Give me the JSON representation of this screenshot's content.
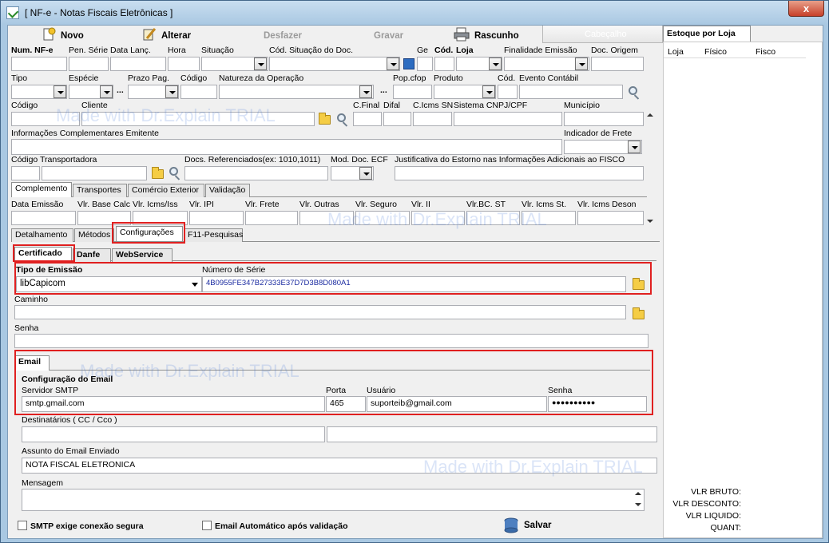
{
  "window": {
    "title": "[ NF-e - Notas Fiscais Eletrônicas ]",
    "close_label": "x"
  },
  "toolbar": {
    "novo": "Novo",
    "alterar": "Alterar",
    "desfazer": "Desfazer",
    "gravar": "Gravar",
    "rascunho": "Rascunho",
    "cabecalho": "Cabeçalho"
  },
  "header_row1": {
    "num_nfe": "Num. NF-e",
    "pen_serie": "Pen. Série",
    "data_lanc": "Data Lanç.",
    "hora": "Hora",
    "situacao": "Situação",
    "cod_situacao": "Cód. Situação do Doc.",
    "ge": "Ge",
    "cod_loja_prefix": "Cód.",
    "cod_loja": "Loja",
    "finalidade": "Finalidade Emissão",
    "doc_origem": "Doc. Origem"
  },
  "header_row2": {
    "tipo": "Tipo",
    "especie": "Espécie",
    "prazo_pag": "Prazo Pag.",
    "codigo": "Código",
    "natureza": "Natureza da Operação",
    "pop_cfop": "Pop.cfop",
    "produto": "Produto",
    "cod_evento": "Cód.",
    "evento_contabil": "Evento Contábil",
    "ellipsis": "..."
  },
  "header_row3": {
    "codigo": "Código",
    "cliente": "Cliente",
    "c_final": "C.Final",
    "difal": "Difal",
    "c_icms_sn": "C.Icms SN",
    "sistema_cnpj": "Sistema CNPJ/CPF",
    "municipio": "Município"
  },
  "header_row4": {
    "info_compl": "Informações Complementares Emitente",
    "indicador_frete": "Indicador de Frete"
  },
  "header_row5": {
    "cod_transportadora": "Código Transportadora",
    "docs_ref": "Docs. Referenciados(ex: 1010,1011)",
    "mod_doc": "Mod. Doc. ECF",
    "justificativa": "Justificativa do Estorno nas Informações Adicionais ao FISCO"
  },
  "tabs1": [
    "Complemento",
    "Transportes",
    "Comércio Exterior",
    "Validação"
  ],
  "complemento": [
    "Data Emissão",
    "Vlr. Base Calc",
    "Vlr. Icms/Iss",
    "Vlr. IPI",
    "Vlr. Frete",
    "Vlr. Outras",
    "Vlr. Seguro",
    "Vlr. II",
    "Vlr.BC. ST",
    "Vlr. Icms St.",
    "Vlr. Icms Deson"
  ],
  "tabs2": [
    "Detalhamento",
    "Métodos",
    "Configurações",
    "F11-Pesquisas"
  ],
  "tabs3": [
    "Certificado",
    "Danfe",
    "WebService"
  ],
  "certificado": {
    "tipo_emissao_label": "Tipo de Emissão",
    "tipo_emissao_value": "libCapicom",
    "numero_serie_label": "Número de Série",
    "numero_serie_value": "4B0955FE347B27333E37D7D3B8D080A1",
    "caminho_label": "Caminho",
    "senha_label": "Senha"
  },
  "email": {
    "tab": "Email",
    "group_title": "Configuração do Email",
    "servidor_label": "Servidor SMTP",
    "servidor_value": "smtp.gmail.com",
    "porta_label": "Porta",
    "porta_value": "465",
    "usuario_label": "Usuário",
    "usuario_value": "suporteib@gmail.com",
    "senha_label": "Senha",
    "senha_value": "●●●●●●●●●●",
    "destinatarios_label": "Destinatários ( CC / Cco )",
    "assunto_label": "Assunto do Email Enviado",
    "assunto_value": "NOTA FISCAL ELETRONICA",
    "mensagem_label": "Mensagem",
    "smtp_seguro": "SMTP exige conexão segura",
    "email_auto": "Email Automático após validação",
    "salvar": "Salvar"
  },
  "estoque": {
    "tab": "Estoque por Loja",
    "cols": [
      "Loja",
      "Físico",
      "Fisco"
    ],
    "vlr_bruto": "VLR BRUTO:",
    "vlr_desconto": "VLR DESCONTO:",
    "vlr_liquido": "VLR LIQUIDO:",
    "quant": "QUANT:"
  },
  "watermark": {
    "made_with": "Made with",
    "brand": "Dr.Explain",
    "trial": "TRIAL"
  }
}
